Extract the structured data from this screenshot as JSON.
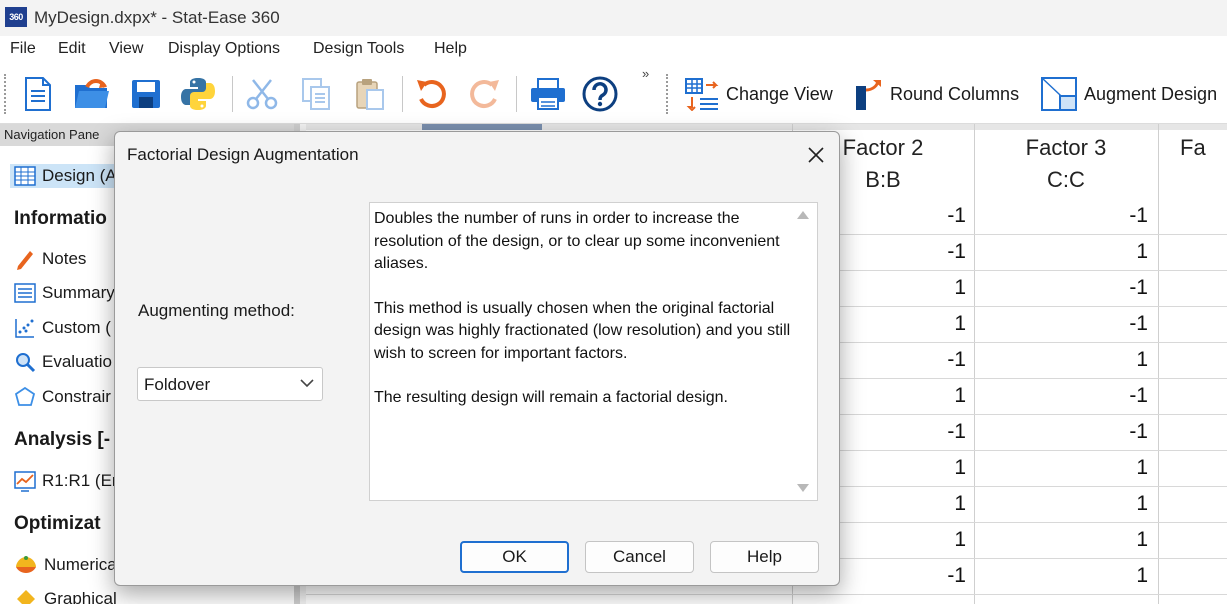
{
  "window": {
    "logo_text": "360",
    "title": "MyDesign.dxpx* - Stat-Ease 360"
  },
  "menu": [
    "File",
    "Edit",
    "View",
    "Display Options",
    "Design Tools",
    "Help"
  ],
  "toolbar": {
    "more_label": "»",
    "change_view": "Change View",
    "round_columns": "Round Columns",
    "augment_design": "Augment Design"
  },
  "nav": {
    "header": "Navigation Pane",
    "design_item": "Design (A",
    "section_information": "Informatio",
    "notes": "Notes",
    "summary": "Summary",
    "custom": "Custom (",
    "evaluation": "Evaluatio",
    "constraints": "Constrair",
    "section_analysis": "Analysis [-",
    "r1": "R1:R1 (Er",
    "section_optimization": "Optimizat",
    "numerical": "Numerica",
    "graphical": "Graphical"
  },
  "grid": {
    "col2_name": "Factor 2",
    "col2_code": "B:B",
    "col3_name": "Factor 3",
    "col3_code": "C:C",
    "col4_name": "Fa",
    "col2_values": [
      "-1",
      "-1",
      "1",
      "1",
      "-1",
      "1",
      "-1",
      "1",
      "1",
      "1",
      "-1"
    ],
    "col3_values": [
      "-1",
      "1",
      "-1",
      "-1",
      "1",
      "-1",
      "-1",
      "1",
      "1",
      "1",
      "1"
    ]
  },
  "dialog": {
    "title": "Factorial Design Augmentation",
    "method_label": "Augmenting method:",
    "method_value": "Foldover",
    "description": [
      "Doubles the number of runs in order to increase the resolution of the design, or to clear up some inconvenient aliases.",
      "This method is usually chosen when the original factorial design was highly fractionated (low resolution) and you still wish to screen for important factors.",
      "The resulting design will remain a factorial design."
    ],
    "ok": "OK",
    "cancel": "Cancel",
    "help": "Help"
  }
}
